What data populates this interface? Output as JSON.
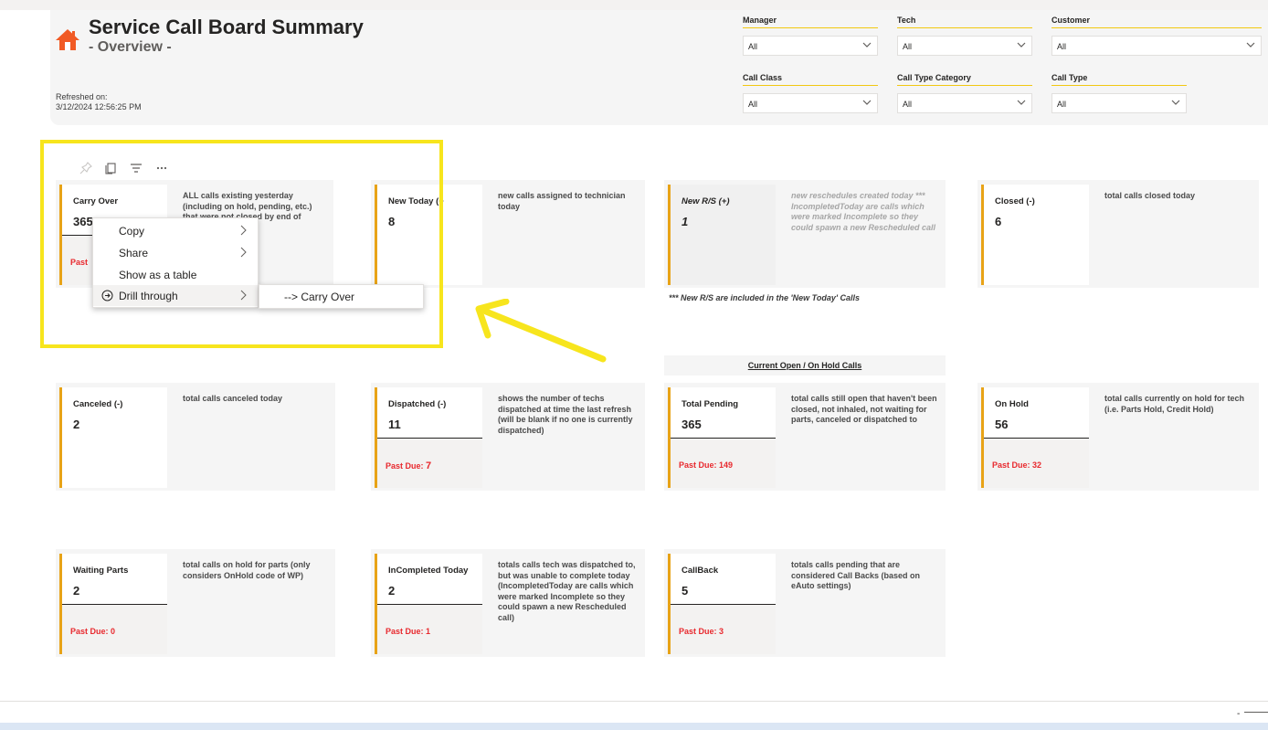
{
  "header": {
    "title": "Service Call Board Summary",
    "subtitle": "- Overview -",
    "refreshed_label": "Refreshed on:",
    "refreshed_value": "3/12/2024 12:56:25 PM"
  },
  "slicers": [
    {
      "label": "Manager",
      "value": "All"
    },
    {
      "label": "Tech",
      "value": "All"
    },
    {
      "label": "Customer",
      "value": "All"
    },
    {
      "label": "Call Class",
      "value": "All"
    },
    {
      "label": "Call Type Category",
      "value": "All"
    },
    {
      "label": "Call Type",
      "value": "All"
    }
  ],
  "cards": {
    "carry_over": {
      "name": "Carry Over",
      "value": "365",
      "past_due_label": "Past",
      "desc": "ALL calls existing yesterday (including on hold, pending, etc.) that were not closed by end of"
    },
    "new_today": {
      "name": "New Today (+",
      "value": "8",
      "desc": "new calls assigned to technician today"
    },
    "new_rs": {
      "name": "New R/S (+)",
      "value": "1",
      "desc": "new reschedules created today *** IncompletedToday are calls which were marked Incomplete so they could spawn a new Rescheduled call"
    },
    "closed": {
      "name": "Closed (-)",
      "value": "6",
      "desc": "total calls closed today"
    },
    "canceled": {
      "name": "Canceled (-)",
      "value": "2",
      "desc": "total calls canceled today"
    },
    "dispatched": {
      "name": "Dispatched (-)",
      "value": "11",
      "past_due_label": "Past Due:",
      "past_due_value": "7",
      "desc": "shows the number of techs dispatched at time the last refresh (will be blank if no one is currently dispatched)"
    },
    "total_pending": {
      "name": "Total Pending",
      "value": "365",
      "past_due_label": "Past Due:",
      "past_due_value": "149",
      "desc": "total calls still open that haven't been closed, not inhaled, not waiting for parts, canceled or dispatched to"
    },
    "on_hold": {
      "name": "On Hold",
      "value": "56",
      "past_due_label": "Past Due:",
      "past_due_value": "32",
      "desc": "total calls currently on hold for tech (i.e. Parts Hold, Credit Hold)"
    },
    "waiting_parts": {
      "name": "Waiting Parts",
      "value": "2",
      "past_due_label": "Past Due:",
      "past_due_value": "0",
      "desc": "total calls on hold for parts (only considers OnHold code of WP)"
    },
    "incompleted_today": {
      "name": "InCompleted Today",
      "value": "2",
      "past_due_label": "Past Due:",
      "past_due_value": "1",
      "desc": "totals calls tech was dispatched to, but was unable to complete today (IncompletedToday are calls which were marked Incomplete so they could spawn a new Rescheduled call)"
    },
    "callback": {
      "name": "CallBack",
      "value": "5",
      "past_due_label": "Past Due:",
      "past_due_value": "3",
      "desc": "totals calls pending that are considered Call Backs (based on eAuto settings)"
    }
  },
  "notes": {
    "rs_note": "*** New R/S are included in the 'New Today' Calls",
    "current_header": "Current Open / On Hold Calls"
  },
  "context_menu": {
    "items": [
      {
        "label": "Copy"
      },
      {
        "label": "Share"
      },
      {
        "label": "Show as a table"
      },
      {
        "label": "Drill through"
      }
    ],
    "submenu_item": "--> Carry Over"
  },
  "icons": {
    "home": "home-icon",
    "toolbar": [
      "pin-icon",
      "copy-icon",
      "filter-icon",
      "more-options-icon"
    ]
  },
  "colors": {
    "accent": "#e8a317",
    "past_due": "#e8292e",
    "highlight_box": "#f7e51d",
    "home_icon": "#f15a24"
  }
}
